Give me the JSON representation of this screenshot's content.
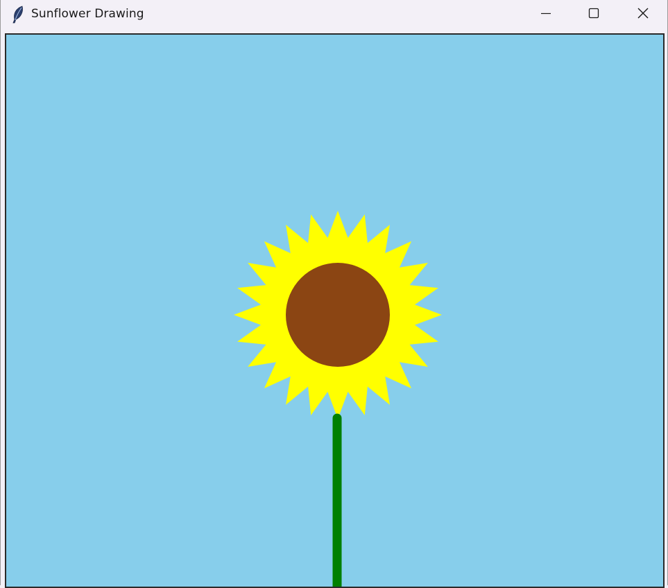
{
  "window": {
    "title": "Sunflower Drawing",
    "app_icon": "feather-icon",
    "controls": {
      "minimize_icon": "minimize-icon",
      "maximize_icon": "maximize-icon",
      "close_icon": "close-icon"
    }
  },
  "canvas": {
    "background_color": "#87ceeb",
    "sunflower": {
      "petal_count": 24,
      "petal_color": "#ffff00",
      "center_color": "#8b4513",
      "stem_color": "#008000"
    }
  }
}
